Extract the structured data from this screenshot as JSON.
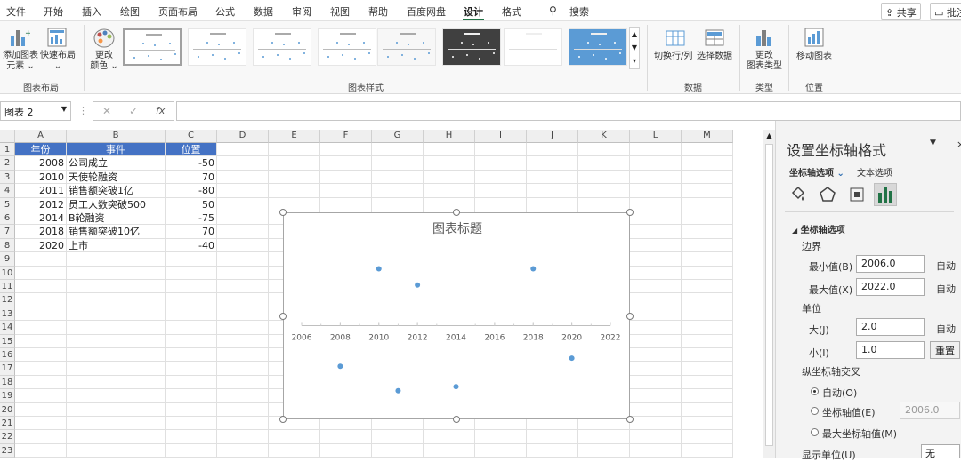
{
  "tabs": [
    "文件",
    "开始",
    "插入",
    "绘图",
    "页面布局",
    "公式",
    "数据",
    "审阅",
    "视图",
    "帮助",
    "百度网盘",
    "设计",
    "格式"
  ],
  "search_label": "搜索",
  "share_label": "共享",
  "comment_label": "批注",
  "ribbon": {
    "add_element": "添加图表\n元素 ⌄",
    "quick_layout": "快速布局\n⌄",
    "group_layout": "图表布局",
    "change_color": "更改\n颜色 ⌄",
    "group_styles": "图表样式",
    "switch_row_col": "切换行/列",
    "select_data": "选择数据",
    "group_data": "数据",
    "change_type": "更改\n图表类型",
    "group_type": "类型",
    "move_chart": "移动图表",
    "group_location": "位置"
  },
  "namebox": "图表 2",
  "columns": [
    "A",
    "B",
    "C",
    "D",
    "E",
    "F",
    "G",
    "H",
    "I",
    "J",
    "K",
    "L",
    "M"
  ],
  "rows": [
    "1",
    "2",
    "3",
    "4",
    "5",
    "6",
    "7",
    "8",
    "9",
    "10",
    "11",
    "12",
    "13",
    "14",
    "15",
    "16",
    "17",
    "18",
    "19",
    "20",
    "21",
    "22",
    "23"
  ],
  "table": {
    "headers": [
      "年份",
      "事件",
      "位置"
    ],
    "rows": [
      [
        "2008",
        "公司成立",
        "-50"
      ],
      [
        "2010",
        "天使轮融资",
        "70"
      ],
      [
        "2011",
        "销售额突破1亿",
        "-80"
      ],
      [
        "2012",
        "员工人数突破500",
        "50"
      ],
      [
        "2014",
        "B轮融资",
        "-75"
      ],
      [
        "2018",
        "销售额突破10亿",
        "70"
      ],
      [
        "2020",
        "上市",
        "-40"
      ]
    ]
  },
  "chart_data": {
    "type": "scatter",
    "title": "图表标题",
    "x": [
      2008,
      2010,
      2011,
      2012,
      2014,
      2018,
      2020
    ],
    "y": [
      -50,
      70,
      -80,
      50,
      -75,
      70,
      -40
    ],
    "xlim": [
      2006,
      2022
    ],
    "ylim": [
      -100,
      100
    ],
    "xticks": [
      "2006",
      "2008",
      "2010",
      "2012",
      "2014",
      "2016",
      "2018",
      "2020",
      "2022"
    ],
    "grid": false,
    "color": "#5b9bd5"
  },
  "panel": {
    "title": "设置坐标轴格式",
    "tab_axis": "坐标轴选项",
    "tab_text": "文本选项",
    "section": "坐标轴选项",
    "bounds": "边界",
    "min_label": "最小值(B)",
    "min_value": "2006.0",
    "max_label": "最大值(X)",
    "max_value": "2022.0",
    "auto": "自动",
    "units": "单位",
    "major_label": "大(J)",
    "major_value": "2.0",
    "minor_label": "小(I)",
    "minor_value": "1.0",
    "reset": "重置",
    "cross": "纵坐标轴交叉",
    "opt_auto": "自动(O)",
    "opt_value": "坐标轴值(E)",
    "opt_value_input": "2006.0",
    "opt_max": "最大坐标轴值(M)",
    "display_units": "显示单位(U)",
    "display_units_value": "无"
  }
}
